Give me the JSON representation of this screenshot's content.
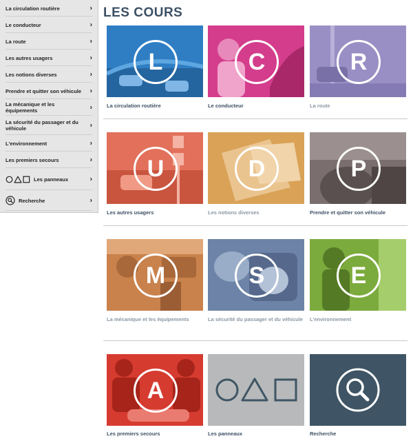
{
  "title": "LES COURS",
  "sidebar": {
    "items": [
      {
        "label": "La circulation routière"
      },
      {
        "label": "Le conducteur"
      },
      {
        "label": "La route"
      },
      {
        "label": "Les autres usagers"
      },
      {
        "label": "Les notions diverses"
      },
      {
        "label": "Prendre et quitter son véhicule"
      },
      {
        "label": "La mécanique et les équipements"
      },
      {
        "label": "La sécurité du passager et du véhicule"
      },
      {
        "label": "L'environnement"
      },
      {
        "label": "Les premiers secours"
      },
      {
        "label": "Les panneaux"
      },
      {
        "label": "Recherche"
      }
    ]
  },
  "cards": [
    {
      "letter": "L",
      "caption": "La circulation routière",
      "color": "#2f7ec4"
    },
    {
      "letter": "C",
      "caption": "Le conducteur",
      "color": "#d43d8c"
    },
    {
      "letter": "R",
      "caption": "La route",
      "color": "#9a8fc4"
    },
    {
      "letter": "U",
      "caption": "Les autres usagers",
      "color": "#e2705a"
    },
    {
      "letter": "D",
      "caption": "Les notions diverses",
      "color": "#d9a257"
    },
    {
      "letter": "P",
      "caption": "Prendre et quitter son véhicule",
      "color": "#7a6e6e"
    },
    {
      "letter": "M",
      "caption": "La mécanique et les équipements",
      "color": "#c9824c"
    },
    {
      "letter": "S",
      "caption": "La sécurité du passager et du véhicule",
      "color": "#6d84a8"
    },
    {
      "letter": "E",
      "caption": "L'environnement",
      "color": "#7cab3d"
    },
    {
      "letter": "A",
      "caption": "Les premiers secours",
      "color": "#d63b30"
    },
    {
      "letter": "",
      "caption": "Les panneaux",
      "color": "#b7b9ba"
    },
    {
      "letter": "",
      "caption": "Recherche",
      "color": "#3f5565"
    }
  ]
}
